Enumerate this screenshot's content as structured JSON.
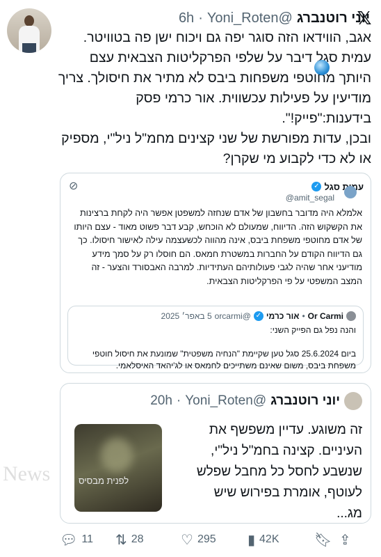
{
  "tweet": {
    "name": "יוני רוטנברג",
    "handle": "@Yoni_Roten",
    "dot": "·",
    "time": "6h",
    "text": "אגב, הווידאו הזה סוגר יפה גם ויכוח ישן פה בטוויטר.\nעמית סגל דיבר על שלפי הפרקליטות הצבאית עצם היותך מחוטפי משפחות ביבס לא מתיר את חיסולך. צריך מודיעין על פעילות עכשווית. אור כרמי פסק בידענות:\"פייק!\".\nובכן, עדות מפורשת של שני קצינים מחמ\"ל ניל\"י, מספיק או לא כדי לקבוע מי שקרן?"
  },
  "quoted_tweet": {
    "name": "עמית סגל",
    "handle": "@amit_segal",
    "text": "אלמלא היה מדובר בחשבון של אדם שנחזה למשפטן אפשר היה לקחת ברצינות את הקשקוש הזה. הדיווח, שמעולם לא הוכחש, קבע דבר פשוט מאוד - עצם היותו של אדם מחוטפי משפחת ביבס, אינה מהווה לכשעצמה עילה לאישור חיסולו. כך גם הדיווח הקודם על החברות במשטרת חמאס. הם חוסלו רק על סמך מידע מודיעני אחר שהיה לגבי פעולותיהם העתידיות. למרבה האבסורד והצער - זה המצב המשפטי על פי הפרקליטות הצבאית.",
    "inner": {
      "name": "אור כרמי",
      "latin_name": "Or Carmi",
      "handle": "@orcarmi",
      "date": "5 באפר׳ 2025",
      "text": "והנה נפל גם הפייק השני:\n\nביום 25.6.2024 סגל טען שקיימת \"הנחיה משפטית\" שמונעת את חיסול חוטפי משפחת ביבס, משום שאינם משתייכים לחמאס או לג'יהאד האיסלאמי."
    }
  },
  "quote": {
    "name": "יוני רוטנברג",
    "handle": "@Yoni_Roten",
    "time": "20h",
    "text": "זה משוגע. עדיין משפשף את העיניים. קצינה בחמ\"ל ניל\"י, שנשבע לחסל כל מחבל שפלש לעוטף, אומרת בפירוש שיש מג...",
    "thumb_caption": "לפנית מבסיס"
  },
  "actions": {
    "replies": "11",
    "retweets": "28",
    "likes": "295",
    "views": "42K"
  },
  "watermark": "News"
}
